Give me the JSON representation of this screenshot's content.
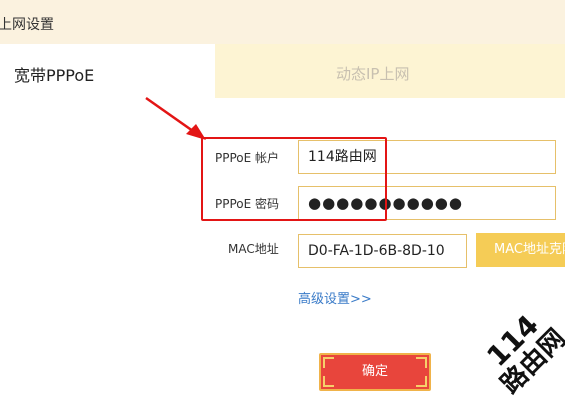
{
  "header": {
    "title": "上网设置"
  },
  "tabs": [
    {
      "label": "宽带PPPoE",
      "active": true
    },
    {
      "label": "动态IP上网",
      "active": false
    }
  ],
  "form": {
    "account_label": "PPPoE 帐户",
    "account_value": "114路由网",
    "password_label": "PPPoE 密码",
    "password_value": "●●●●●●●●●●●",
    "mac_label": "MAC地址",
    "mac_value": "D0-FA-1D-6B-8D-10",
    "mac_clone_label": "MAC地址克隆",
    "advanced_link": "高级设置>>",
    "confirm_label": "确定"
  },
  "watermark": {
    "number": "114",
    "text": "路由网"
  },
  "colors": {
    "header_bg": "#fbf2df",
    "inactive_tab_bg": "#fdf4d3",
    "field_border": "#e6c06a",
    "clone_button": "#f5cc56",
    "link": "#3a7bc8",
    "confirm_button": "#e8453c",
    "annotation_red": "#e31515"
  }
}
